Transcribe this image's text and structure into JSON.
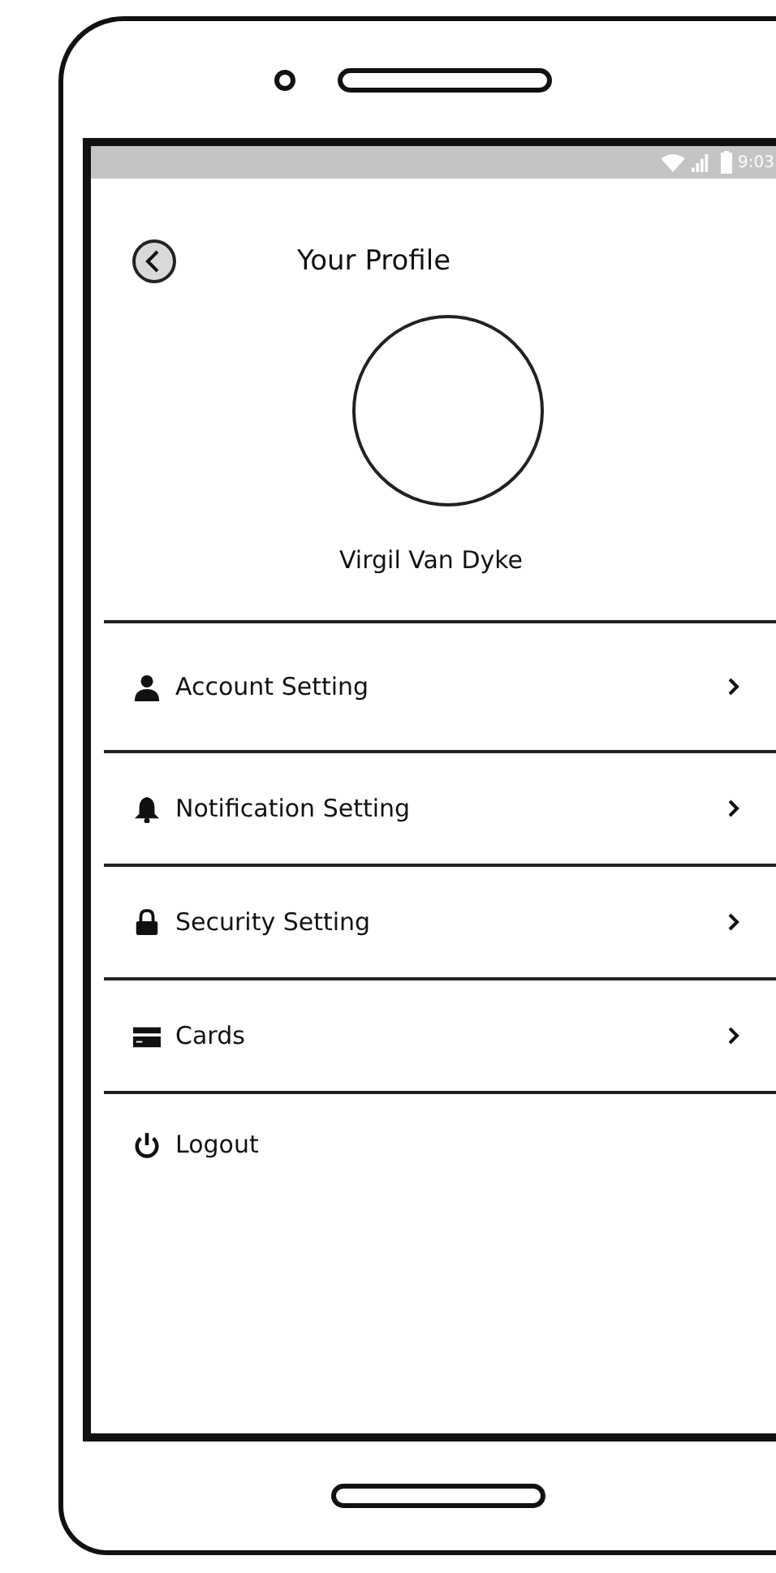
{
  "status_bar": {
    "time": "9:03"
  },
  "header": {
    "title": "Your Profile"
  },
  "profile": {
    "name": "Virgil Van Dyke"
  },
  "menu": [
    {
      "label": "Account Setting",
      "kind": "person",
      "chevron": true
    },
    {
      "label": "Notification Setting",
      "kind": "bell",
      "chevron": true
    },
    {
      "label": "Security Setting",
      "kind": "lock",
      "chevron": true
    },
    {
      "label": "Cards",
      "kind": "card",
      "chevron": true
    },
    {
      "label": "Logout",
      "kind": "power",
      "chevron": false
    }
  ]
}
